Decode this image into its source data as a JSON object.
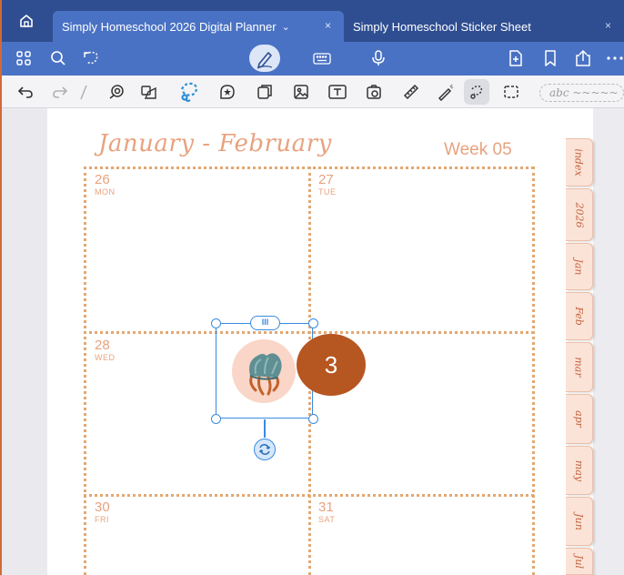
{
  "tabs": {
    "active_label": "Simply Homeschool 2026 Digital Planner",
    "active_chevron": "⌄",
    "inactive_label": "Simply Homeschool Sticker Sheet",
    "close_glyph": "×"
  },
  "toolbar_icons": [
    "grid-icon",
    "search-icon",
    "lasso-icon",
    "pen-icon",
    "keyboard-icon",
    "microphone-icon",
    "add-page-icon",
    "bookmark-icon",
    "share-icon",
    "more-icon"
  ],
  "tools_icons": [
    "undo-icon",
    "redo-icon",
    "pen-tool-icon",
    "eraser-icon",
    "shapes-icon",
    "lasso-tool-icon",
    "sticker-icon",
    "element-icon",
    "image-icon",
    "text-box-icon",
    "camera-icon",
    "ruler-icon",
    "laser-pointer-icon",
    "handwriting-lasso-icon",
    "selection-rect-icon"
  ],
  "text_style_placeholder": "abc ~~~~~",
  "planner": {
    "title": "January - February",
    "week": "Week 05",
    "days": [
      {
        "num": "26",
        "name": "MON"
      },
      {
        "num": "27",
        "name": "TUE"
      },
      {
        "num": "28",
        "name": "WED"
      },
      {
        "num": "30",
        "name": "FRI"
      },
      {
        "num": "31",
        "name": "SAT"
      }
    ],
    "side_tabs": [
      "index",
      "2026",
      "Jan",
      "Feb",
      "mar",
      "apr",
      "may",
      "Jun",
      "Jul"
    ]
  },
  "selection": {
    "grip_label": "III",
    "step_number": "3"
  },
  "colors": {
    "tabbar": "#2f4e91",
    "toolbar": "#4a72c4",
    "accent": "#e8a27f",
    "selection": "#3a8be0",
    "badge": "#b65621"
  }
}
